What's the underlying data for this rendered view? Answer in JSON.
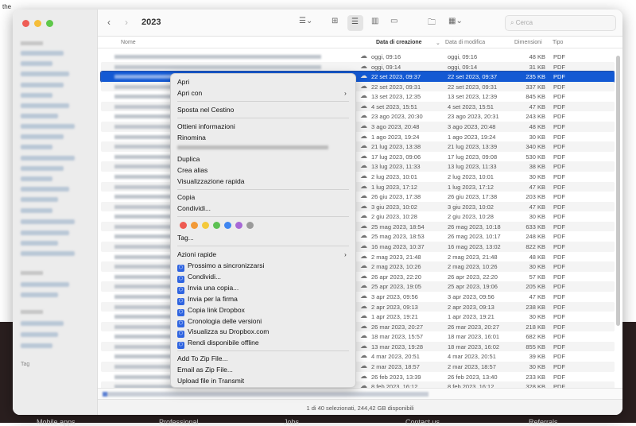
{
  "background": {
    "top_text": "the",
    "footer_links": [
      "Mobile apps",
      "Professional",
      "Jobs",
      "Contact us",
      "Referrals"
    ]
  },
  "toolbar": {
    "title": "2023",
    "search_placeholder": "Cerca"
  },
  "sidebar": {
    "tag_label": "Tag"
  },
  "columns": {
    "name": "Nome",
    "created": "Data di creazione",
    "modified": "Data di modifica",
    "size": "Dimensioni",
    "kind": "Tipo"
  },
  "files": [
    {
      "created": "oggi, 09:16",
      "modified": "oggi, 09:16",
      "size": "48 KB",
      "kind": "PDF"
    },
    {
      "created": "oggi, 09:14",
      "modified": "oggi, 09:14",
      "size": "31 KB",
      "kind": "PDF"
    },
    {
      "created": "22 set 2023, 09:37",
      "modified": "22 set 2023, 09:37",
      "size": "235 KB",
      "kind": "PDF",
      "selected": true
    },
    {
      "created": "22 set 2023, 09:31",
      "modified": "22 set 2023, 09:31",
      "size": "337 KB",
      "kind": "PDF"
    },
    {
      "created": "13 set 2023, 12:35",
      "modified": "13 set 2023, 12:39",
      "size": "845 KB",
      "kind": "PDF"
    },
    {
      "created": "4 set 2023, 15:51",
      "modified": "4 set 2023, 15:51",
      "size": "47 KB",
      "kind": "PDF"
    },
    {
      "created": "23 ago 2023, 20:30",
      "modified": "23 ago 2023, 20:31",
      "size": "243 KB",
      "kind": "PDF"
    },
    {
      "created": "3 ago 2023, 20:48",
      "modified": "3 ago 2023, 20:48",
      "size": "48 KB",
      "kind": "PDF"
    },
    {
      "created": "1 ago 2023, 19:24",
      "modified": "1 ago 2023, 19:24",
      "size": "30 KB",
      "kind": "PDF"
    },
    {
      "created": "21 lug 2023, 13:38",
      "modified": "21 lug 2023, 13:39",
      "size": "340 KB",
      "kind": "PDF"
    },
    {
      "created": "17 lug 2023, 09:06",
      "modified": "17 lug 2023, 09:08",
      "size": "530 KB",
      "kind": "PDF"
    },
    {
      "created": "13 lug 2023, 11:33",
      "modified": "13 lug 2023, 11:33",
      "size": "38 KB",
      "kind": "PDF"
    },
    {
      "created": "2 lug 2023, 10:01",
      "modified": "2 lug 2023, 10:01",
      "size": "30 KB",
      "kind": "PDF"
    },
    {
      "created": "1 lug 2023, 17:12",
      "modified": "1 lug 2023, 17:12",
      "size": "47 KB",
      "kind": "PDF"
    },
    {
      "created": "26 giu 2023, 17:38",
      "modified": "26 giu 2023, 17:38",
      "size": "203 KB",
      "kind": "PDF"
    },
    {
      "created": "3 giu 2023, 10:02",
      "modified": "3 giu 2023, 10:02",
      "size": "47 KB",
      "kind": "PDF"
    },
    {
      "created": "2 giu 2023, 10:28",
      "modified": "2 giu 2023, 10:28",
      "size": "30 KB",
      "kind": "PDF"
    },
    {
      "created": "25 mag 2023, 18:54",
      "modified": "26 mag 2023, 10:18",
      "size": "633 KB",
      "kind": "PDF"
    },
    {
      "created": "25 mag 2023, 18:53",
      "modified": "26 mag 2023, 10:17",
      "size": "248 KB",
      "kind": "PDF"
    },
    {
      "created": "16 mag 2023, 10:37",
      "modified": "16 mag 2023, 13:02",
      "size": "822 KB",
      "kind": "PDF"
    },
    {
      "created": "2 mag 2023, 21:48",
      "modified": "2 mag 2023, 21:48",
      "size": "48 KB",
      "kind": "PDF"
    },
    {
      "created": "2 mag 2023, 10:26",
      "modified": "2 mag 2023, 10:26",
      "size": "30 KB",
      "kind": "PDF"
    },
    {
      "created": "26 apr 2023, 22:20",
      "modified": "26 apr 2023, 22:20",
      "size": "57 KB",
      "kind": "PDF"
    },
    {
      "created": "25 apr 2023, 19:05",
      "modified": "25 apr 2023, 19:06",
      "size": "205 KB",
      "kind": "PDF"
    },
    {
      "created": "3 apr 2023, 09:56",
      "modified": "3 apr 2023, 09:56",
      "size": "47 KB",
      "kind": "PDF"
    },
    {
      "created": "2 apr 2023, 09:13",
      "modified": "2 apr 2023, 09:13",
      "size": "238 KB",
      "kind": "PDF"
    },
    {
      "created": "1 apr 2023, 19:21",
      "modified": "1 apr 2023, 19:21",
      "size": "30 KB",
      "kind": "PDF"
    },
    {
      "created": "26 mar 2023, 20:27",
      "modified": "26 mar 2023, 20:27",
      "size": "218 KB",
      "kind": "PDF"
    },
    {
      "created": "18 mar 2023, 15:57",
      "modified": "18 mar 2023, 16:01",
      "size": "682 KB",
      "kind": "PDF"
    },
    {
      "created": "13 mar 2023, 19:28",
      "modified": "18 mar 2023, 16:02",
      "size": "855 KB",
      "kind": "PDF"
    },
    {
      "created": "4 mar 2023, 20:51",
      "modified": "4 mar 2023, 20:51",
      "size": "39 KB",
      "kind": "PDF"
    },
    {
      "created": "2 mar 2023, 18:57",
      "modified": "2 mar 2023, 18:57",
      "size": "30 KB",
      "kind": "PDF"
    },
    {
      "created": "26 feb 2023, 13:39",
      "modified": "26 feb 2023, 13:40",
      "size": "233 KB",
      "kind": "PDF"
    },
    {
      "created": "8 feb 2023, 16:12",
      "modified": "8 feb 2023, 16:12",
      "size": "328 KB",
      "kind": "PDF"
    }
  ],
  "status": "1 di 40 selezionati, 244,42 GB disponibili",
  "context_menu": {
    "open": "Apri",
    "open_with": "Apri con",
    "trash": "Sposta nel Cestino",
    "info": "Ottieni informazioni",
    "rename": "Rinomina",
    "duplicate": "Duplica",
    "alias": "Crea alias",
    "quicklook": "Visualizzazione rapida",
    "copy": "Copia",
    "share": "Condividi...",
    "tag_colors": [
      "#ee5a52",
      "#f29a38",
      "#f4c93b",
      "#5cc153",
      "#3f86f0",
      "#a768d6",
      "#9a9a9a"
    ],
    "tags": "Tag...",
    "quick_actions": "Azioni rapide",
    "dropbox": [
      "Prossimo a sincronizzarsi",
      "Condividi...",
      "Invia una copia...",
      "Invia per la firma",
      "Copia link Dropbox",
      "Cronologia delle versioni",
      "Visualizza su Dropbox.com",
      "Rendi disponibile offline"
    ],
    "zip": "Add To Zip File...",
    "email_zip": "Email as Zip File...",
    "transmit": "Upload file in Transmit"
  }
}
